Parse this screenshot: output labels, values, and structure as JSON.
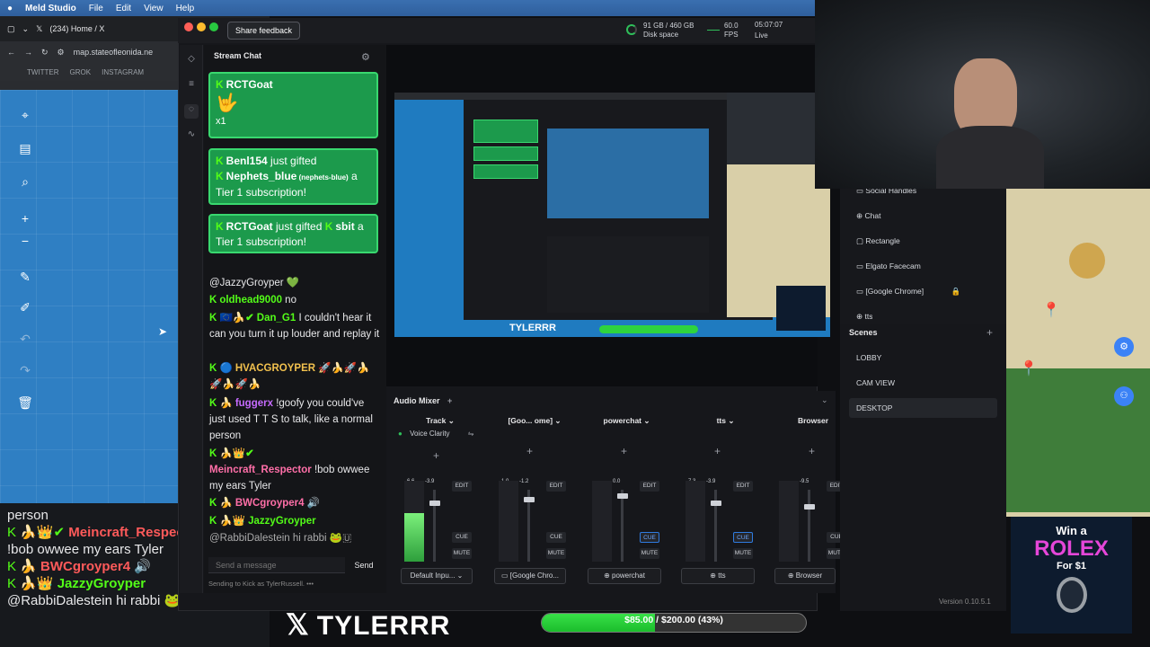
{
  "menubar": {
    "apple": "",
    "app": "Meld Studio",
    "items": [
      "File",
      "Edit",
      "View",
      "Help"
    ]
  },
  "browser": {
    "tab_title": "(234) Home / X",
    "url": "map.stateofleonida.ne",
    "bookmarks": [
      "TWITTER",
      "GROK",
      "INSTAGRAM"
    ]
  },
  "overlay_chat": [
    {
      "prefix": "",
      "user": "",
      "text": "person",
      "user_color": "#fff"
    },
    {
      "prefix": "K 🍌👑✔",
      "user": "Meincraft_Respector",
      "text": "",
      "user_color": "#ff5a5a"
    },
    {
      "prefix": "",
      "user": "",
      "text": "!bob owwee my ears Tyler",
      "user_color": "#fff"
    },
    {
      "prefix": "K 🍌",
      "user": "BWCgroyper4",
      "text": "🔊",
      "user_color": "#ff5a5a"
    },
    {
      "prefix": "K 🍌👑",
      "user": "JazzyGroyper",
      "text": "",
      "user_color": "#53fc18"
    },
    {
      "prefix": "",
      "user": "@RabbiDalestein",
      "text": " hi rabbi 🐸🇺",
      "user_color": "#fff"
    }
  ],
  "meld": {
    "share_feedback": "Share feedback",
    "disk": "91 GB / 460 GB",
    "disk_label": "Disk space",
    "fps": "60.0",
    "fps_label": "FPS",
    "time": "05:07:07",
    "live_label": "Live",
    "version": "Version 0.10.5.1"
  },
  "chat": {
    "title": "Stream Chat",
    "gift1_user": "RCTGoat",
    "gift1_emoji": "🤟",
    "gift1_count": "x1",
    "gift2_a": "Benl154",
    "gift2_b": " just gifted ",
    "gift2_c": "Nephets_blue",
    "gift2_d": " (nephets-blue)",
    "gift2_e": " a Tier 1 subscription!",
    "gift3_a": "RCTGoat",
    "gift3_b": " just gifted ",
    "gift3_c": "sbit",
    "gift3_d": " a Tier 1 subscription!",
    "messages": [
      {
        "badges": "",
        "user": "",
        "text": "@JazzyGroyper 💚",
        "color": "#e8e8ea"
      },
      {
        "badges": "K",
        "user": "oldhead9000",
        "text": " no",
        "color": "#53fc18"
      },
      {
        "badges": "K 🇪🇺🍌✔",
        "user": "Dan_G1",
        "text": " I couldn't hear it can you turn it up louder and replay it",
        "color": "#53fc18"
      },
      {
        "badges": "K 🔵",
        "user": "HVACGROYPER",
        "text": " 🚀🍌🚀🍌🚀🍌🚀🍌",
        "color": "#f2c14e"
      },
      {
        "badges": "K 🍌",
        "user": "fuggerx",
        "text": " !goofy you could've just used T T S to talk, like a normal person",
        "color": "#c66bff"
      },
      {
        "badges": "K 🍌👑✔",
        "user": "Meincraft_Respector",
        "text": " !bob owwee my ears Tyler",
        "color": "#ff6fa8"
      },
      {
        "badges": "K 🍌",
        "user": "BWCgroyper4",
        "text": " 🔊",
        "color": "#ff6fa8"
      },
      {
        "badges": "K 🍌👑",
        "user": "JazzyGroyper",
        "text": "",
        "color": "#53fc18"
      },
      {
        "badges": "",
        "user": "@RabbiDalestein",
        "text": " hi rabbi 🐸🇺",
        "color": "#e8e8ea"
      }
    ],
    "input_placeholder": "Send a message",
    "send": "Send",
    "sending_as": "Sending to Kick as TylerRussell."
  },
  "mixer": {
    "title": "Audio Mixer",
    "voice_clarity": "Voice Clarity",
    "edit": "EDIT",
    "cue": "CUE",
    "mute": "MUTE",
    "channels": [
      {
        "name": "Track",
        "source": "Default Inpu...",
        "db1": "-6.6",
        "db2": "-3.9",
        "level": 0.6,
        "fader": 0.85
      },
      {
        "name": "[Goo... ome]",
        "source": "[Google Chro...",
        "db1": "-1.0",
        "db2": "-1.2",
        "level": 0.0,
        "fader": 0.9
      },
      {
        "name": "powerchat",
        "source": "powerchat",
        "db1": "",
        "db2": "0.0",
        "level": 0.0,
        "fader": 0.95
      },
      {
        "name": "tts",
        "source": "tts",
        "db1": "-7.3",
        "db2": "-3.9",
        "level": 0.0,
        "fader": 0.85
      },
      {
        "name": "Browser",
        "source": "Browser",
        "db1": "",
        "db2": "-9.5",
        "level": 0.0,
        "fader": 0.8
      }
    ]
  },
  "layers": [
    "Social Handles",
    "Chat",
    "Rectangle",
    "Elgato Facecam",
    "[Google Chrome]",
    "tts"
  ],
  "scenes": {
    "title": "Scenes",
    "items": [
      "LOBBY",
      "CAM VIEW",
      "DESKTOP"
    ],
    "active": "DESKTOP"
  },
  "overlay": {
    "brand": "TYLERRR",
    "goal_text": "$85.00 / $200.00 (43%)",
    "goal_fraction": 0.43
  },
  "ad": {
    "line1": "Win a",
    "line2": "ROLEX",
    "line3": "For $1"
  },
  "preview_brand": "TYLERRR"
}
